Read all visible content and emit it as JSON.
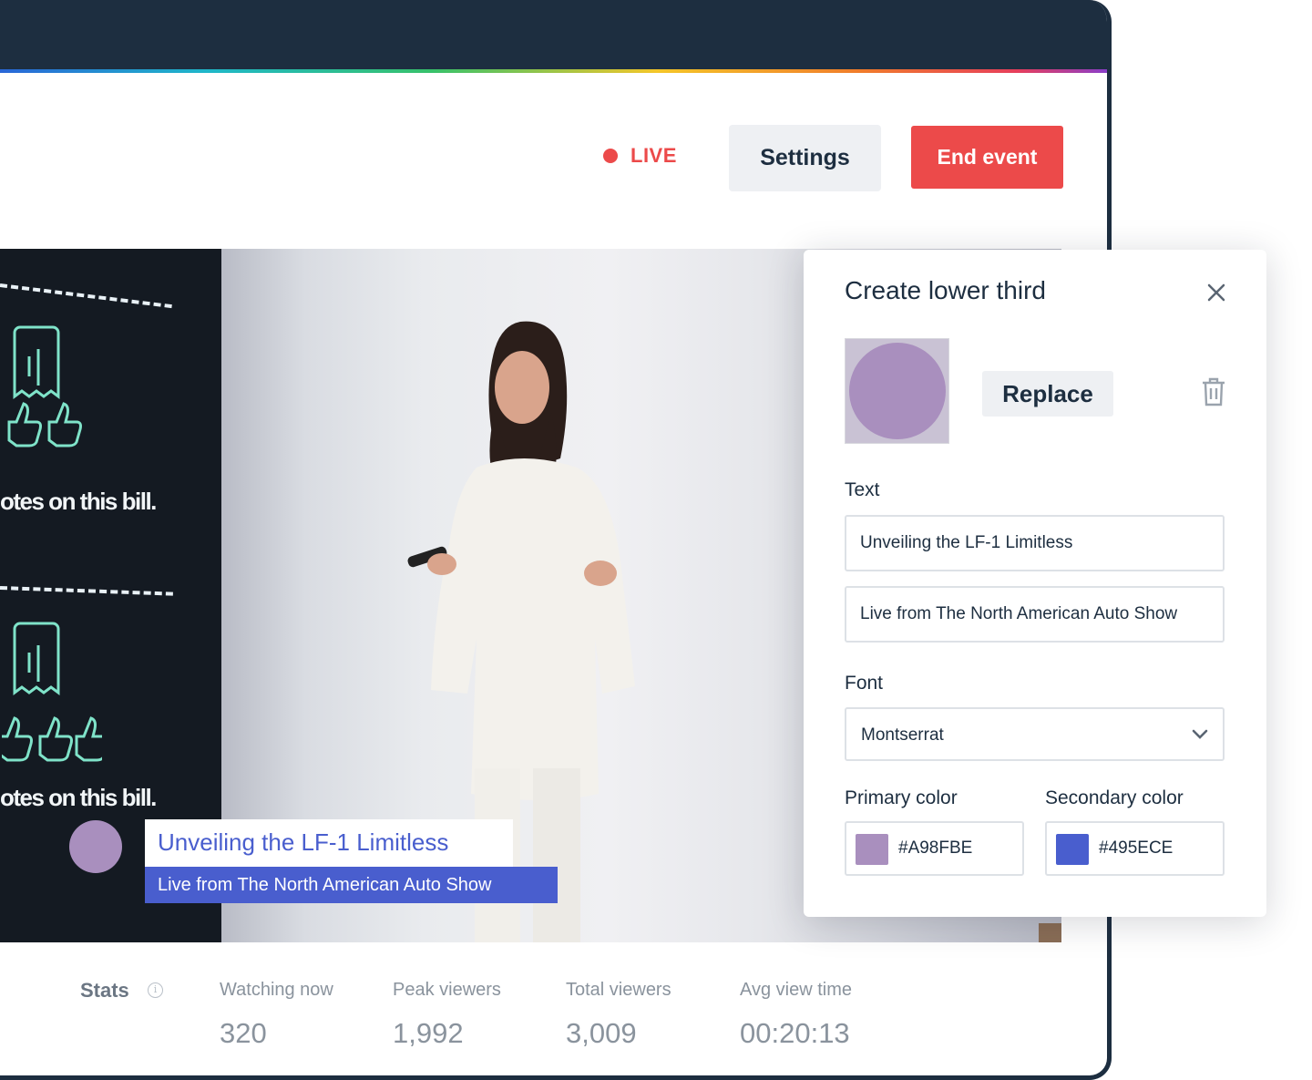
{
  "header": {
    "live_label": "LIVE",
    "settings_label": "Settings",
    "end_event_label": "End event"
  },
  "video": {
    "screen_text_1": "otes on this bill.",
    "screen_text_2": "otes on this bill.",
    "lower_third": {
      "title": "Unveiling the LF-1 Limitless",
      "subtitle": "Live from The North American Auto Show"
    }
  },
  "stats": {
    "label": "Stats",
    "items": [
      {
        "label": "Watching now",
        "value": "320"
      },
      {
        "label": "Peak viewers",
        "value": "1,992"
      },
      {
        "label": "Total viewers",
        "value": "3,009"
      },
      {
        "label": "Avg view time",
        "value": "00:20:13"
      }
    ]
  },
  "panel": {
    "title": "Create lower third",
    "replace_label": "Replace",
    "text_label": "Text",
    "text_line1": "Unveiling the LF-1 Limitless",
    "text_line2": "Live from The North American Auto Show",
    "font_label": "Font",
    "font_value": "Montserrat",
    "primary_label": "Primary color",
    "primary_hex": "#A98FBE",
    "secondary_label": "Secondary color",
    "secondary_hex": "#495ECE"
  },
  "colors": {
    "live": "#ec4a4a",
    "end_button": "#ec4a4a",
    "primary": "#a98fbe",
    "secondary": "#495ece",
    "titlebar": "#1d2e40"
  },
  "icons": [
    "live-dot-icon",
    "close-icon",
    "trash-icon",
    "chevron-down-icon",
    "info-icon",
    "thumbs-up-icon",
    "receipt-icon"
  ]
}
